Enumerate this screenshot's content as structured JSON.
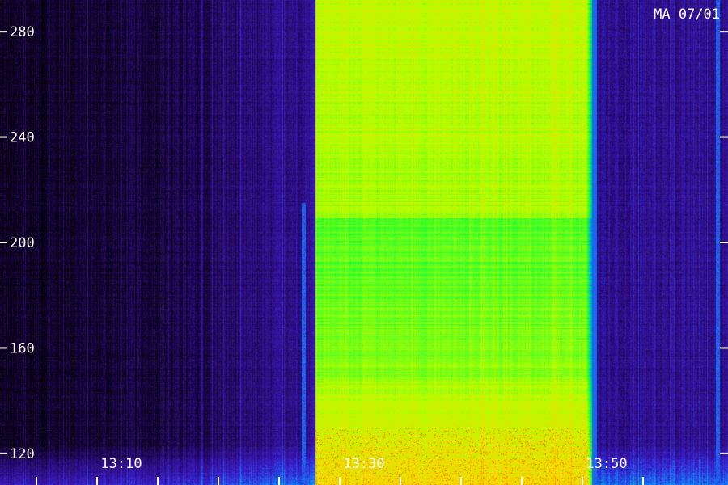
{
  "station_label": "MA 07/01",
  "chart_data": {
    "type": "heatmap",
    "title": "",
    "xlabel": "",
    "ylabel": "",
    "y_ticks": [
      120,
      160,
      200,
      240,
      280
    ],
    "y_tick_labels": [
      "120",
      "160",
      "200",
      "240",
      "280"
    ],
    "ylim": [
      108,
      292
    ],
    "x_minor_ticks_minutes": [
      -2,
      3,
      8,
      13,
      18,
      23,
      28,
      33,
      38,
      43,
      48,
      53
    ],
    "x_major_labels": [
      "13:10",
      "13:30",
      "13:50"
    ],
    "x_major_minutes": [
      10,
      30,
      50
    ],
    "xlim_minutes": [
      0,
      60
    ],
    "burst": {
      "start_minute": 26,
      "end_minute": 48.8,
      "intensity": "high"
    },
    "colormap": [
      "#000000",
      "#2a0a6e",
      "#3b1fd0",
      "#0a8cff",
      "#00ff3c",
      "#b4ff00",
      "#ffd200",
      "#ff2000"
    ],
    "grid": false
  }
}
